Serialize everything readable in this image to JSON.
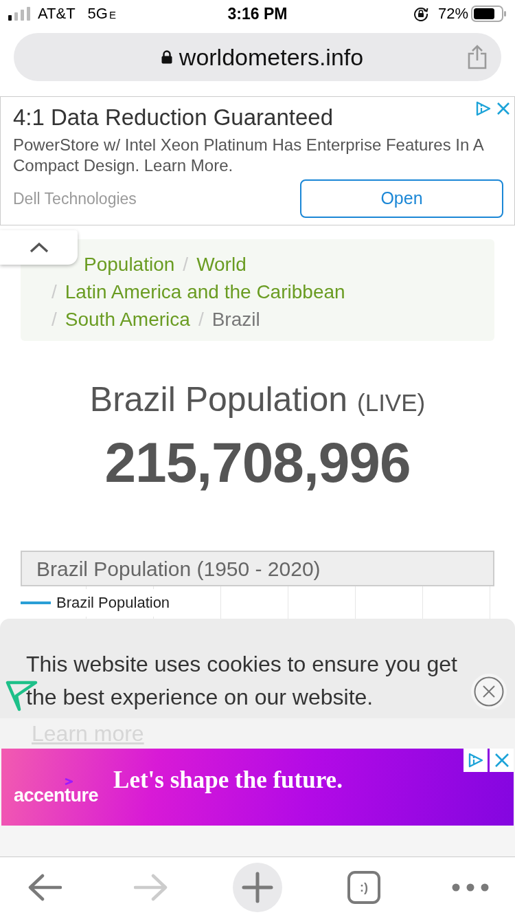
{
  "status_bar": {
    "carrier": "AT&T",
    "network": "5G",
    "network_suffix": "E",
    "time": "3:16 PM",
    "battery": "72%"
  },
  "address_bar": {
    "url": "worldometers.info",
    "secure": true
  },
  "top_ad": {
    "headline": "4:1 Data Reduction Guaranteed",
    "body": "PowerStore w/ Intel Xeon Platinum Has Enterprise Features In A Compact Design. Learn More.",
    "advertiser": "Dell Technologies",
    "button": "Open"
  },
  "breadcrumb": [
    {
      "label": "Population",
      "current": false
    },
    {
      "separator": "/",
      "label": "World",
      "current": false
    },
    {
      "separator": "/",
      "label": "Latin America and the Caribbean",
      "current": false
    },
    {
      "separator": "/",
      "label": "South America",
      "current": false
    },
    {
      "separator": "/",
      "label": "Brazil",
      "current": true
    }
  ],
  "headline": {
    "title": "Brazil Population",
    "badge": "(LIVE)",
    "count": "215,708,996"
  },
  "chart": {
    "title": "Brazil Population (1950 - 2020)",
    "legend": [
      {
        "label": "Brazil Population",
        "color": "#2a9fd6"
      }
    ]
  },
  "cookie_banner": {
    "message": "This website uses cookies to ensure you get the best experience on our website.",
    "link": "Learn more"
  },
  "bottom_ad": {
    "brand": "accenture",
    "tagline": "Let's shape the future."
  },
  "toolbar": [
    {
      "kind": "back",
      "disabled": false
    },
    {
      "kind": "forward",
      "disabled": true
    },
    {
      "kind": "new_tab",
      "disabled": false
    },
    {
      "kind": "tabs",
      "label": ":)",
      "disabled": false
    },
    {
      "kind": "menu",
      "disabled": false
    }
  ]
}
